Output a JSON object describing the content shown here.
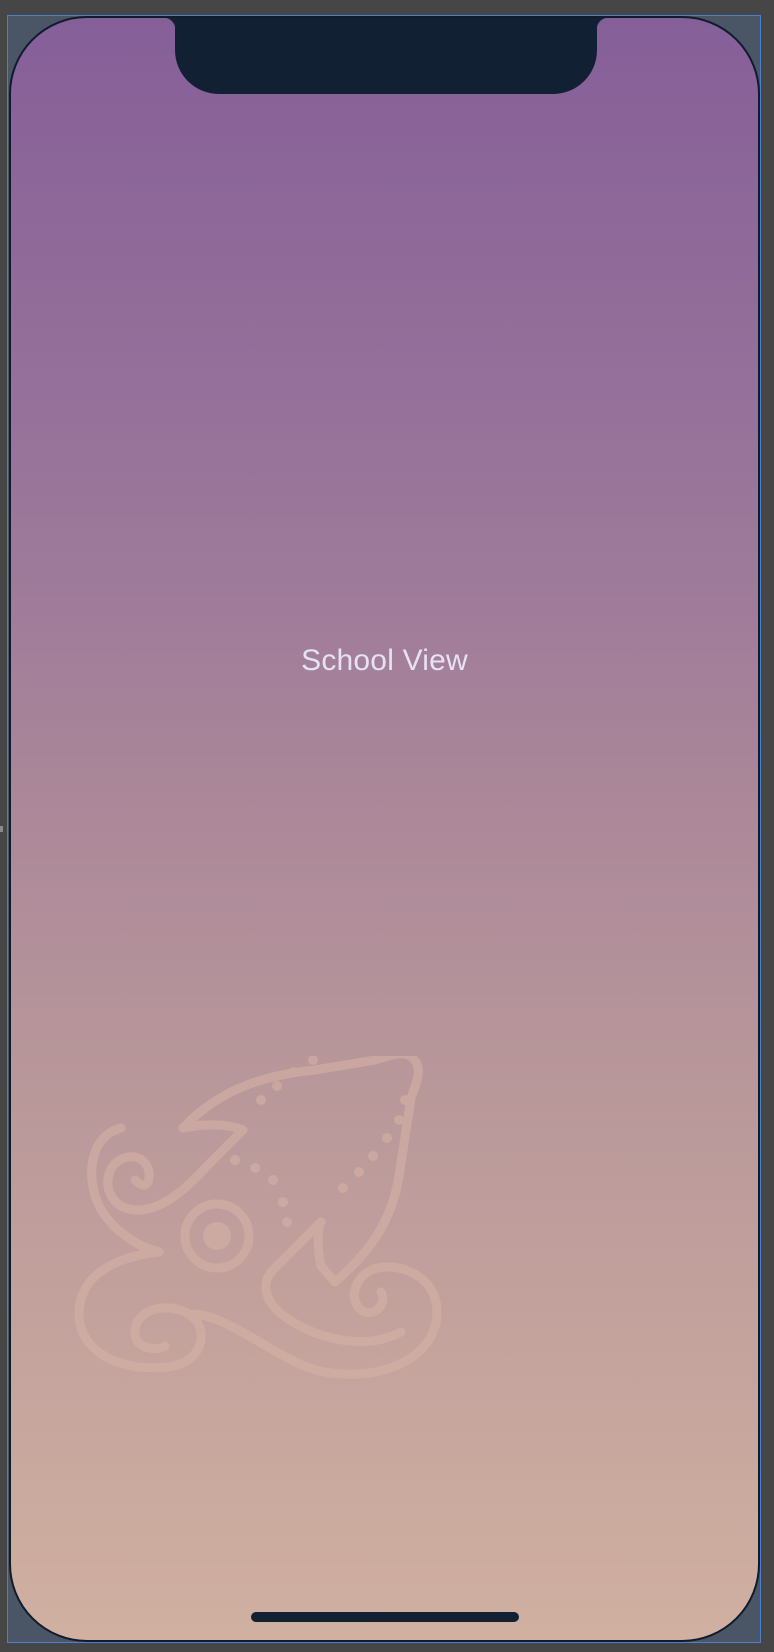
{
  "screen": {
    "title": "School View"
  },
  "device": {
    "model_frame": "iphone-notch-frame",
    "gradient_top": "#855f98",
    "gradient_bottom": "#d0b0a0"
  },
  "watermark": {
    "icon": "decorative-swirl-icon",
    "color": "#d4b0a4"
  },
  "colors": {
    "canvas_background": "#464646",
    "notch": "#122033",
    "title_text": "#e6e2f6"
  }
}
